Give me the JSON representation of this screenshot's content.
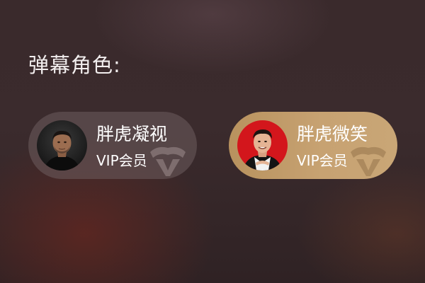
{
  "header": {
    "title": "弹幕角色:"
  },
  "roles": [
    {
      "name": "胖虎凝视",
      "tier": "VIP会员",
      "selected": false,
      "avatar_icon": "man-portrait-icon",
      "watermark_icon": "vip-badge-icon"
    },
    {
      "name": "胖虎微笑",
      "tier": "VIP会员",
      "selected": true,
      "avatar_icon": "man-portrait-icon",
      "watermark_icon": "vip-badge-icon"
    }
  ],
  "colors": {
    "selected_card": "#c29d6b",
    "plain_card": "#6e5c5e",
    "text": "#ffffff"
  }
}
